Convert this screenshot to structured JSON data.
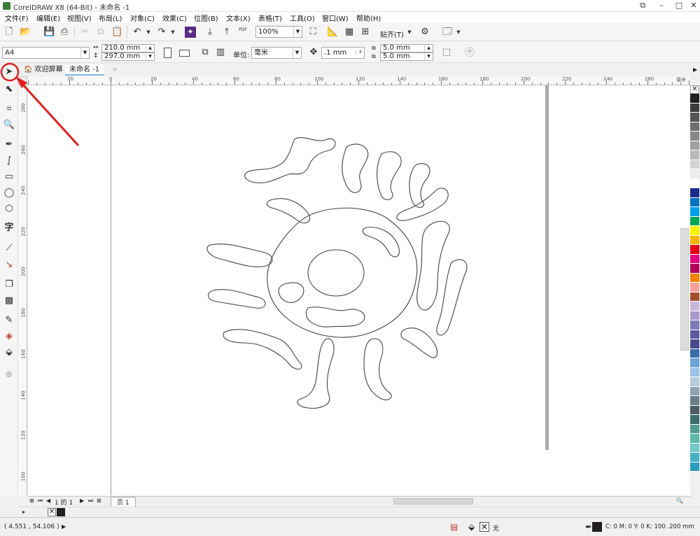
{
  "window": {
    "title": "CorelDRAW X8 (64-Bit) - 未命名 -1"
  },
  "menu": [
    "文件(F)",
    "编辑(E)",
    "视图(V)",
    "布局(L)",
    "对象(C)",
    "效果(C)",
    "位图(B)",
    "文本(X)",
    "表格(T)",
    "工具(O)",
    "窗口(W)",
    "帮助(H)"
  ],
  "toolbar": {
    "zoom": "100%",
    "snap": "贴齐(T)",
    "pdf_label": "PDF"
  },
  "propbar": {
    "page_size": "A4",
    "width": "210.0 mm",
    "height": "297.0 mm",
    "units_label": "单位:",
    "units": "毫米",
    "nudge": ".1 mm",
    "dup_x": "5.0 mm",
    "dup_y": "5.0 mm"
  },
  "tabs": [
    {
      "label": "欢迎屏幕",
      "icon": "home-icon"
    },
    {
      "label": "未命名 -1"
    }
  ],
  "ruler": {
    "h_labels": [
      "20",
      "0",
      "20",
      "40",
      "60",
      "80",
      "100",
      "120",
      "140",
      "160",
      "180",
      "200",
      "220",
      "240",
      "260"
    ],
    "unit": "毫米",
    "v_labels": [
      "280",
      "260",
      "240",
      "220",
      "200",
      "180",
      "160",
      "140",
      "120",
      "100",
      "80",
      "60",
      "40"
    ]
  },
  "page_nav": {
    "counter": "1 的 1",
    "page_tab": "页 1"
  },
  "status": {
    "coords": "( 4.551 , 54.106 )",
    "fill_none": "无",
    "outline": "C: 0 M: 0 Y: 0 K: 100  .200 mm"
  },
  "palette_colors": [
    "#231f20",
    "#3c3c3c",
    "#555555",
    "#6e6e6e",
    "#878787",
    "#a0a0a0",
    "#b9b9b9",
    "#d2d2d2",
    "#ebebeb",
    "#ffffff",
    "#1e2d8c",
    "#0070c0",
    "#00a0e9",
    "#00a651",
    "#fff200",
    "#f7b500",
    "#e60012",
    "#e4007f",
    "#b2005c",
    "#f08300",
    "#f4a09c",
    "#a0522d",
    "#c9b7dc",
    "#a99bcc",
    "#7f79b8",
    "#5c5a9e",
    "#4a4a8c",
    "#3a6ea8",
    "#6ba3d6",
    "#9cc3e5",
    "#b5cbd8",
    "#8fa3b0",
    "#6c7f8a",
    "#4f5b62",
    "#3b6e6a",
    "#4f9b8f",
    "#5fb7a8",
    "#70c9c6",
    "#45b3c6",
    "#2b9bb8"
  ]
}
